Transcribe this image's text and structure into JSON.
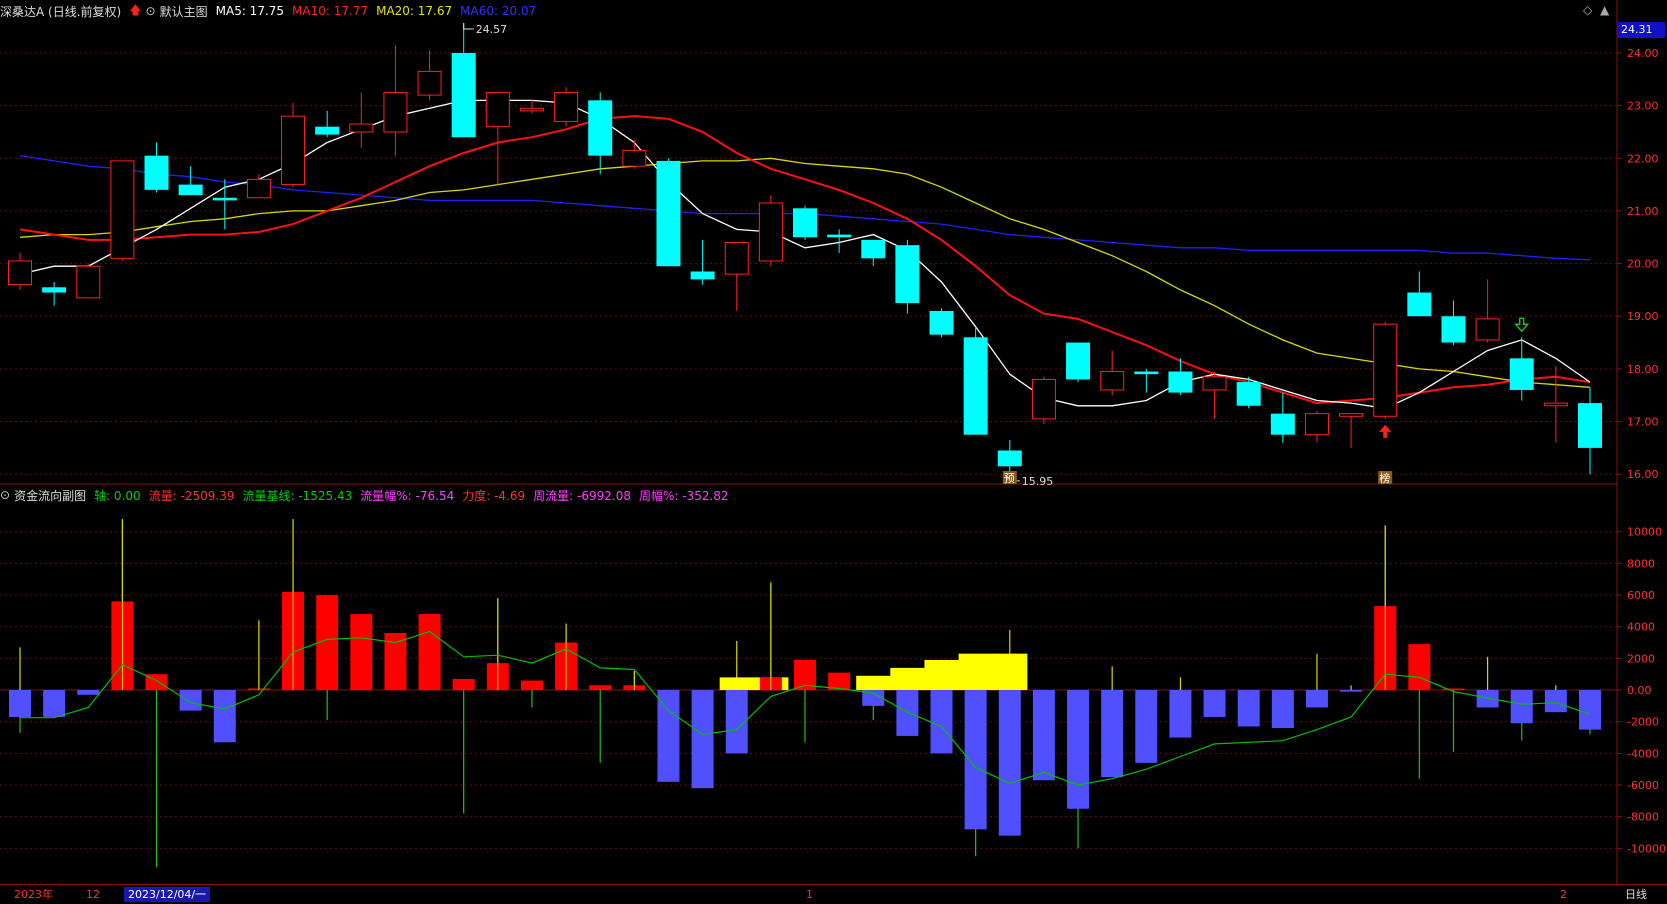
{
  "header": {
    "title": "深桑达A (日线.前复权)",
    "template": "默认主图",
    "ma5": "MA5: 17.75",
    "ma10": "MA10: 17.77",
    "ma20": "MA20: 17.67",
    "ma60": "MA60: 20.07"
  },
  "sub_header": {
    "title": "资金流向副图",
    "axis": "轴: 0.00",
    "flow": "流量: -2509.39",
    "flow_base": "流量基线: -1525.43",
    "flow_pct": "流量幅%: -76.54",
    "force": "力度: -4.69",
    "week_flow": "周流量: -6992.08",
    "week_pct": "周幅%: -352.82"
  },
  "price_tag": "24.31",
  "right_axis_label": "日线",
  "bottom_axis": {
    "year": "2023年",
    "month12": "12",
    "cursor_date": "2023/12/04/一",
    "month1": "1",
    "month2": "2"
  },
  "annotations": {
    "high": "24.57",
    "low": "15.95",
    "mark_yu": "预",
    "mark_bang": "榜"
  },
  "colors": {
    "up": "#ff2020",
    "down": "#00ffff",
    "ma5": "#ffffff",
    "ma10": "#ff1010",
    "ma20": "#d8d800",
    "ma60": "#2020ff",
    "flow_pos": "#ff0000",
    "flow_neg": "#5050ff",
    "flow_yellow": "#ffff00",
    "flow_line": "#00c000"
  },
  "chart_data": [
    {
      "type": "candlestick",
      "title": "深桑达A (日线.前复权)",
      "ylim": [
        15.7,
        24.55
      ],
      "y_ticks": [
        "24.00",
        "23.00",
        "22.00",
        "21.00",
        "20.00",
        "19.00",
        "18.00",
        "17.00",
        "16.00"
      ],
      "candles": [
        {
          "o": 19.6,
          "h": 20.2,
          "l": 19.5,
          "c": 20.05
        },
        {
          "o": 19.55,
          "h": 19.65,
          "l": 19.2,
          "c": 19.45
        },
        {
          "o": 19.35,
          "h": 20.0,
          "l": 19.35,
          "c": 19.95
        },
        {
          "o": 20.1,
          "h": 21.95,
          "l": 20.05,
          "c": 21.95
        },
        {
          "o": 22.05,
          "h": 22.3,
          "l": 21.35,
          "c": 21.4
        },
        {
          "o": 21.5,
          "h": 21.85,
          "l": 21.3,
          "c": 21.3
        },
        {
          "o": 21.25,
          "h": 21.6,
          "l": 20.65,
          "c": 21.2
        },
        {
          "o": 21.25,
          "h": 21.7,
          "l": 21.25,
          "c": 21.6
        },
        {
          "o": 21.5,
          "h": 23.05,
          "l": 21.45,
          "c": 22.8
        },
        {
          "o": 22.6,
          "h": 22.9,
          "l": 22.4,
          "c": 22.45
        },
        {
          "o": 22.5,
          "h": 23.25,
          "l": 22.2,
          "c": 22.65
        },
        {
          "o": 22.5,
          "h": 24.15,
          "l": 22.05,
          "c": 23.25
        },
        {
          "o": 23.2,
          "h": 24.05,
          "l": 23.1,
          "c": 23.65
        },
        {
          "o": 24.0,
          "h": 24.57,
          "l": 22.4,
          "c": 22.4
        },
        {
          "o": 22.6,
          "h": 23.25,
          "l": 21.5,
          "c": 23.25
        },
        {
          "o": 22.9,
          "h": 23.1,
          "l": 22.85,
          "c": 22.95
        },
        {
          "o": 22.7,
          "h": 23.35,
          "l": 22.6,
          "c": 23.25
        },
        {
          "o": 23.1,
          "h": 23.25,
          "l": 21.7,
          "c": 22.05
        },
        {
          "o": 21.85,
          "h": 22.35,
          "l": 21.8,
          "c": 22.15
        },
        {
          "o": 21.95,
          "h": 22.0,
          "l": 19.95,
          "c": 19.95
        },
        {
          "o": 19.85,
          "h": 20.45,
          "l": 19.6,
          "c": 19.7
        },
        {
          "o": 19.8,
          "h": 20.3,
          "l": 19.1,
          "c": 20.4
        },
        {
          "o": 20.05,
          "h": 21.3,
          "l": 19.95,
          "c": 21.15
        },
        {
          "o": 21.05,
          "h": 21.1,
          "l": 20.45,
          "c": 20.5
        },
        {
          "o": 20.55,
          "h": 20.65,
          "l": 20.2,
          "c": 20.5
        },
        {
          "o": 20.45,
          "h": 20.45,
          "l": 19.95,
          "c": 20.1
        },
        {
          "o": 20.35,
          "h": 20.45,
          "l": 19.05,
          "c": 19.25
        },
        {
          "o": 19.1,
          "h": 19.15,
          "l": 18.6,
          "c": 18.65
        },
        {
          "o": 18.6,
          "h": 18.8,
          "l": 16.75,
          "c": 16.75
        },
        {
          "o": 16.45,
          "h": 16.65,
          "l": 15.95,
          "c": 16.15
        },
        {
          "o": 17.05,
          "h": 17.85,
          "l": 16.95,
          "c": 17.8
        },
        {
          "o": 18.5,
          "h": 18.5,
          "l": 17.75,
          "c": 17.8
        },
        {
          "o": 17.6,
          "h": 18.35,
          "l": 17.5,
          "c": 17.95
        },
        {
          "o": 17.95,
          "h": 18.0,
          "l": 17.55,
          "c": 17.9
        },
        {
          "o": 17.95,
          "h": 18.2,
          "l": 17.5,
          "c": 17.55
        },
        {
          "o": 17.6,
          "h": 17.95,
          "l": 17.05,
          "c": 17.85
        },
        {
          "o": 17.75,
          "h": 17.85,
          "l": 17.25,
          "c": 17.3
        },
        {
          "o": 17.15,
          "h": 17.55,
          "l": 16.6,
          "c": 16.75
        },
        {
          "o": 16.75,
          "h": 17.2,
          "l": 16.6,
          "c": 17.15
        },
        {
          "o": 17.1,
          "h": 17.15,
          "l": 16.5,
          "c": 17.15
        },
        {
          "o": 17.1,
          "h": 18.9,
          "l": 17.05,
          "c": 18.85
        },
        {
          "o": 19.45,
          "h": 19.85,
          "l": 19.0,
          "c": 19.0
        },
        {
          "o": 19.0,
          "h": 19.3,
          "l": 18.45,
          "c": 18.5
        },
        {
          "o": 18.55,
          "h": 19.7,
          "l": 18.5,
          "c": 18.95
        },
        {
          "o": 18.2,
          "h": 18.6,
          "l": 17.4,
          "c": 17.6
        },
        {
          "o": 17.3,
          "h": 18.05,
          "l": 16.6,
          "c": 17.35
        },
        {
          "o": 17.35,
          "h": 17.65,
          "l": 16.0,
          "c": 16.5
        }
      ],
      "ma5": [
        19.8,
        19.95,
        19.95,
        20.3,
        20.65,
        21.05,
        21.45,
        21.6,
        21.9,
        22.3,
        22.55,
        22.8,
        22.95,
        23.1,
        23.1,
        23.1,
        23.05,
        22.75,
        22.3,
        21.55,
        20.95,
        20.65,
        20.6,
        20.3,
        20.4,
        20.55,
        20.25,
        19.65,
        18.8,
        17.9,
        17.45,
        17.3,
        17.3,
        17.4,
        17.75,
        17.9,
        17.8,
        17.6,
        17.4,
        17.35,
        17.25,
        17.55,
        17.95,
        18.35,
        18.55,
        18.2,
        17.75
      ],
      "ma10": [
        20.65,
        20.55,
        20.45,
        20.45,
        20.5,
        20.55,
        20.55,
        20.6,
        20.75,
        21.0,
        21.25,
        21.55,
        21.85,
        22.1,
        22.3,
        22.4,
        22.55,
        22.75,
        22.8,
        22.75,
        22.5,
        22.1,
        21.8,
        21.6,
        21.4,
        21.15,
        20.85,
        20.45,
        19.95,
        19.4,
        19.05,
        18.95,
        18.7,
        18.45,
        18.15,
        17.9,
        17.75,
        17.55,
        17.35,
        17.4,
        17.45,
        17.55,
        17.65,
        17.7,
        17.8,
        17.85,
        17.75
      ],
      "ma20": [
        20.5,
        20.55,
        20.55,
        20.6,
        20.7,
        20.8,
        20.85,
        20.95,
        21.0,
        21.0,
        21.1,
        21.2,
        21.35,
        21.4,
        21.5,
        21.6,
        21.7,
        21.8,
        21.85,
        21.9,
        21.95,
        21.95,
        22.0,
        21.9,
        21.85,
        21.8,
        21.7,
        21.45,
        21.15,
        20.85,
        20.65,
        20.4,
        20.15,
        19.85,
        19.5,
        19.2,
        18.85,
        18.55,
        18.3,
        18.2,
        18.1,
        18.0,
        17.95,
        17.85,
        17.75,
        17.7,
        17.65
      ],
      "ma60": [
        22.05,
        21.95,
        21.85,
        21.8,
        21.7,
        21.65,
        21.55,
        21.5,
        21.4,
        21.35,
        21.3,
        21.25,
        21.2,
        21.2,
        21.2,
        21.2,
        21.15,
        21.1,
        21.05,
        21.0,
        20.95,
        20.95,
        20.95,
        20.95,
        20.9,
        20.85,
        20.8,
        20.75,
        20.65,
        20.55,
        20.5,
        20.45,
        20.4,
        20.35,
        20.3,
        20.3,
        20.25,
        20.25,
        20.25,
        20.25,
        20.25,
        20.25,
        20.2,
        20.2,
        20.15,
        20.1,
        20.07
      ]
    },
    {
      "type": "bar",
      "title": "资金流向副图",
      "ylim": [
        -12000,
        11500
      ],
      "y_ticks": [
        "10000",
        "8000",
        "6000",
        "4000",
        "2000",
        "0.00",
        "-2000",
        "-4000",
        "-6000",
        "-8000",
        "-10000"
      ],
      "values": [
        -1700,
        -1700,
        -300,
        5600,
        1000,
        -1300,
        -3300,
        100,
        6200,
        6000,
        4800,
        3600,
        4800,
        700,
        1700,
        600,
        3000,
        300,
        300,
        -5800,
        -6200,
        -4000,
        800,
        1900,
        1100,
        -1000,
        -2900,
        -4000,
        -8800,
        -9200,
        -5700,
        -7500,
        -5500,
        -4600,
        -3000,
        -1700,
        -2300,
        -2400,
        -1100,
        -100,
        5300,
        2900,
        100,
        -1100,
        -2100,
        -1400,
        -2500
      ],
      "yellow": [
        0,
        0,
        0,
        0,
        0,
        0,
        0,
        0,
        0,
        0,
        0,
        0,
        0,
        0,
        0,
        0,
        0,
        0,
        0,
        0,
        0,
        800,
        800,
        0,
        0,
        900,
        1400,
        1900,
        2300,
        2300,
        0,
        0,
        0,
        0,
        0,
        0,
        0,
        0,
        0,
        0,
        0,
        0,
        0,
        0,
        0,
        0,
        0
      ],
      "spikes": [
        [
          -2700,
          2700
        ],
        [
          -1300,
          0
        ],
        [
          0,
          0
        ],
        [
          0,
          10800
        ],
        [
          -11200,
          0
        ],
        [
          0,
          0
        ],
        [
          -1500,
          0
        ],
        [
          0,
          4400
        ],
        [
          0,
          10800
        ],
        [
          -1900,
          0
        ],
        [
          0,
          0
        ],
        [
          0,
          0
        ],
        [
          0,
          0
        ],
        [
          -7800,
          0
        ],
        [
          0,
          5800
        ],
        [
          -1100,
          0
        ],
        [
          0,
          4200
        ],
        [
          -4600,
          0
        ],
        [
          0,
          1200
        ],
        [
          0,
          0
        ],
        [
          0,
          0
        ],
        [
          0,
          3100
        ],
        [
          0,
          6800
        ],
        [
          -3300,
          0
        ],
        [
          0,
          0
        ],
        [
          -1900,
          0
        ],
        [
          0,
          0
        ],
        [
          0,
          0
        ],
        [
          -10500,
          0
        ],
        [
          -2600,
          3800
        ],
        [
          0,
          0
        ],
        [
          -10000,
          0
        ],
        [
          0,
          1500
        ],
        [
          0,
          0
        ],
        [
          -2000,
          800
        ],
        [
          0,
          0
        ],
        [
          0,
          0
        ],
        [
          -1800,
          0
        ],
        [
          0,
          2300
        ],
        [
          0,
          300
        ],
        [
          0,
          10400
        ],
        [
          -5600,
          0
        ],
        [
          -3900,
          0
        ],
        [
          0,
          2100
        ],
        [
          -3200,
          0
        ],
        [
          0,
          300
        ],
        [
          -2800,
          0
        ]
      ],
      "baseline": [
        -1750,
        -1750,
        -1100,
        1600,
        600,
        -800,
        -1200,
        -300,
        2400,
        3200,
        3300,
        3000,
        3700,
        2100,
        2200,
        1700,
        2600,
        1400,
        1300,
        -1300,
        -2800,
        -2500,
        -400,
        300,
        100,
        -200,
        -1400,
        -2300,
        -4900,
        -5900,
        -5200,
        -6000,
        -5600,
        -5000,
        -4200,
        -3400,
        -3300,
        -3200,
        -2500,
        -1700,
        1000,
        800,
        -100,
        -500,
        -900,
        -800,
        -1525
      ]
    }
  ]
}
